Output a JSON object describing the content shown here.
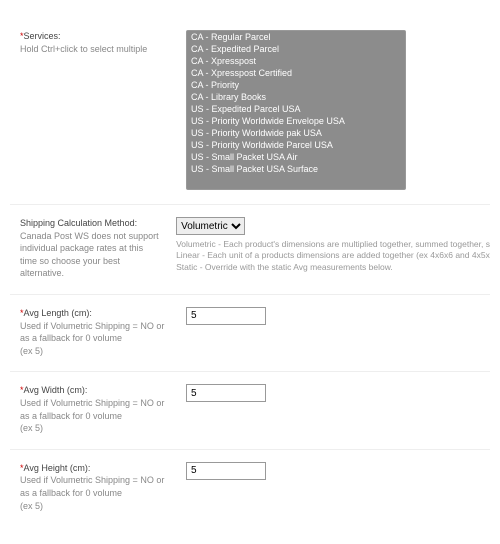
{
  "services": {
    "label": "Services:",
    "tip": "Hold Ctrl+click to select multiple",
    "options": [
      "CA - Regular Parcel",
      "CA - Expedited Parcel",
      "CA - Xpresspost",
      "CA - Xpresspost Certified",
      "CA - Priority",
      "CA - Library Books",
      "US - Expedited Parcel USA",
      "US - Priority Worldwide Envelope USA",
      "US - Priority Worldwide pak USA",
      "US - Priority Worldwide Parcel USA",
      "US - Small Packet USA Air",
      "US - Small Packet USA Surface"
    ]
  },
  "calcMethod": {
    "label": "Shipping Calculation Method:",
    "sub": "Canada Post WS does not support individual package rates at this time so choose your best alternative.",
    "selected": "Volumetric",
    "help": "Volumetric - Each product's dimensions are multiplied together, summed together, s\nLinear - Each unit of a products dimensions are added together (ex 4x6x6 and 4x5x\nStatic - Override with the static Avg measurements below."
  },
  "avgLength": {
    "label": "Avg Length (cm):",
    "sub": "Used if Volumetric Shipping = NO or as a fallback for 0 volume\n(ex 5)",
    "value": "5"
  },
  "avgWidth": {
    "label": "Avg Width (cm):",
    "sub": "Used if Volumetric Shipping = NO or as a fallback for 0 volume\n(ex 5)",
    "value": "5"
  },
  "avgHeight": {
    "label": "Avg Height (cm):",
    "sub": "Used if Volumetric Shipping = NO or as a fallback for 0 volume\n(ex 5)",
    "value": "5"
  }
}
